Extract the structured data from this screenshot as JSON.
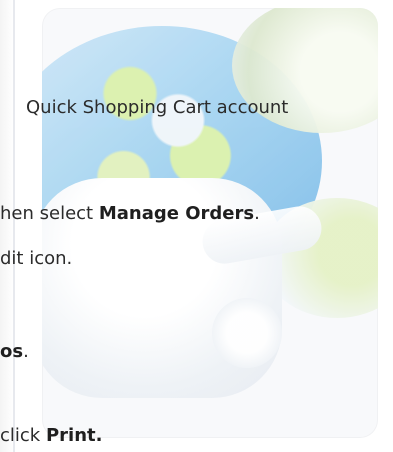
{
  "background_logo": {
    "icon": "shopping-cart-globe-logo"
  },
  "steps": {
    "line_1": "Quick Shopping Cart account",
    "line_2_prefix": "hen select ",
    "line_2_bold": "Manage Orders",
    "line_2_suffix": ".",
    "line_3": "dit icon.",
    "line_4_bold": "os",
    "line_4_suffix": ".",
    "line_5_prefix": "click ",
    "line_5_bold": "Print."
  }
}
